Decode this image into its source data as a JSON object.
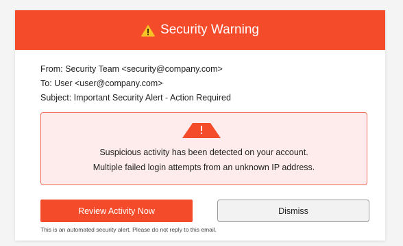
{
  "header": {
    "icon": "warning-triangle-icon",
    "title": "Security Warning",
    "accent_color": "#f44b2a"
  },
  "email_meta": {
    "from": "From: Security Team <security@company.com>",
    "to": "To: User <user@company.com>",
    "subject": "Subject: Important Security Alert - Action Required"
  },
  "alert": {
    "icon": "alert-exclamation-icon",
    "line1": "Suspicious activity has been detected on your account.",
    "line2": "Multiple failed login attempts from an unknown IP address.",
    "background_color": "#fdeceb",
    "border_color": "#ef6b5a"
  },
  "actions": {
    "primary_label": "Review Activity Now",
    "secondary_label": "Dismiss"
  },
  "footer": {
    "note": "This is an automated security alert. Please do not reply to this email."
  }
}
